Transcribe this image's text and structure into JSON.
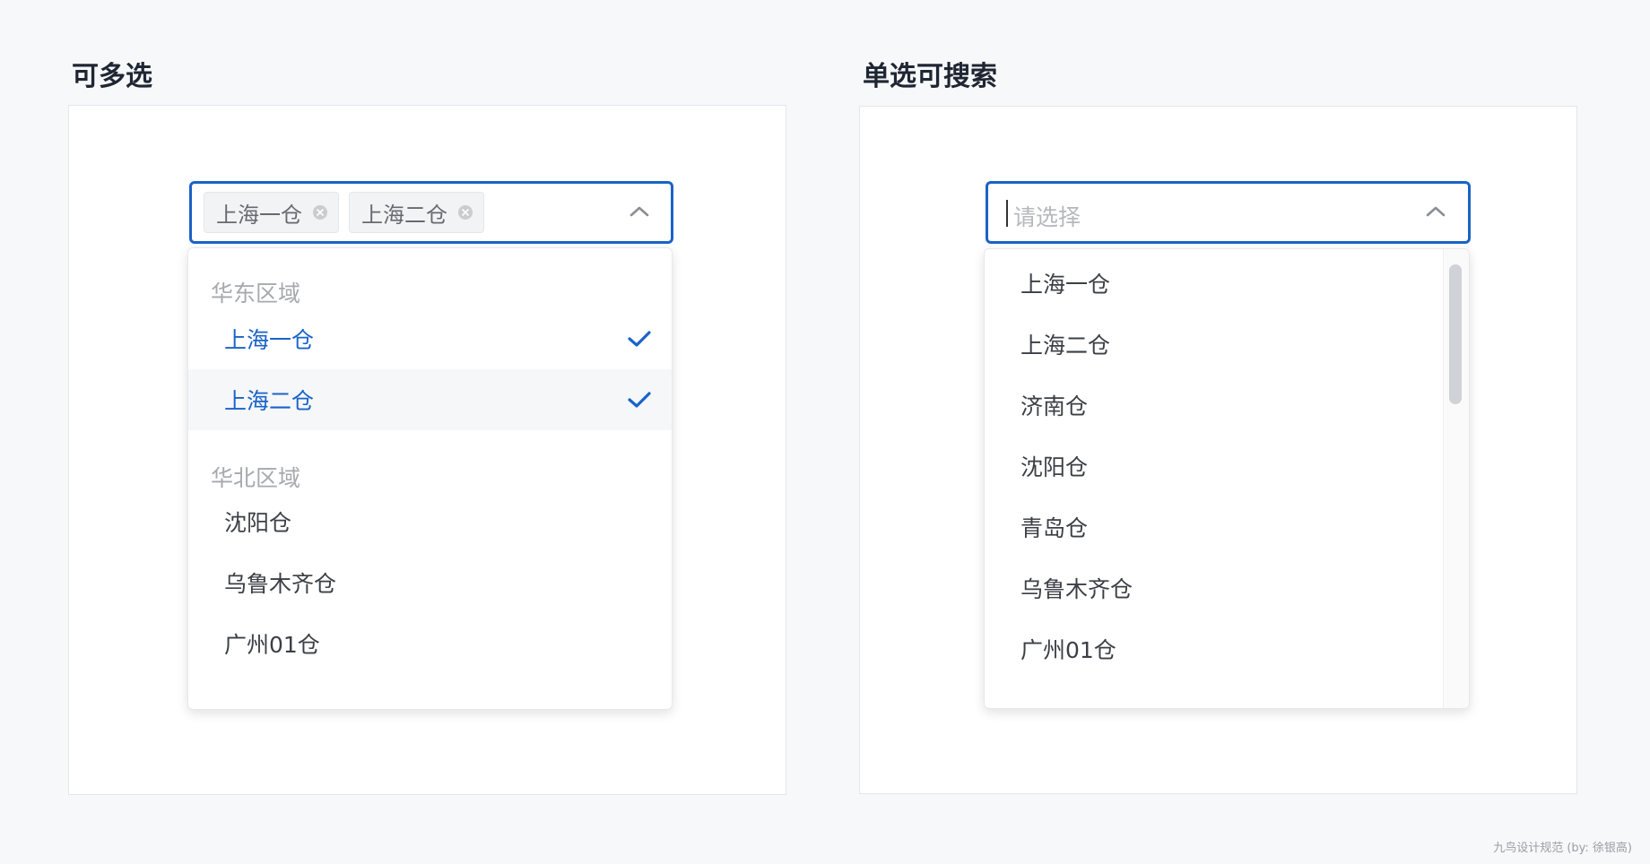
{
  "left": {
    "title": "可多选",
    "tags": [
      {
        "label": "上海一仓"
      },
      {
        "label": "上海二仓"
      }
    ],
    "groups": [
      {
        "label": "华东区域"
      },
      {
        "label": "华北区域"
      }
    ],
    "options": [
      {
        "label": "上海一仓",
        "selected": true
      },
      {
        "label": "上海二仓",
        "selected": true
      },
      {
        "label": "沈阳仓",
        "selected": false
      },
      {
        "label": "乌鲁木齐仓",
        "selected": false
      },
      {
        "label": "广州01仓",
        "selected": false
      }
    ]
  },
  "right": {
    "title": "单选可搜索",
    "placeholder": "请选择",
    "options": [
      {
        "label": "上海一仓"
      },
      {
        "label": "上海二仓"
      },
      {
        "label": "济南仓"
      },
      {
        "label": "沈阳仓"
      },
      {
        "label": "青岛仓"
      },
      {
        "label": "乌鲁木齐仓"
      },
      {
        "label": "广州01仓"
      }
    ]
  },
  "colors": {
    "accent": "#1a63c7",
    "group_label": "#a6a9ae",
    "option_text": "#3b3f45",
    "tag_bg": "#f2f3f5",
    "page_bg": "#f7f8fa"
  },
  "icons": {
    "tag_close": "close-circle-icon",
    "dropdown_arrow": "chevron-up-icon",
    "selected_mark": "check-icon"
  },
  "watermark": "九鸟设计规范 (by: 徐银高)"
}
